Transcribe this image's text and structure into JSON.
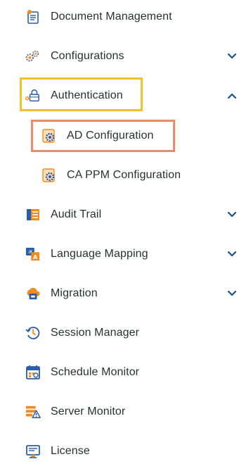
{
  "menu": {
    "document_management": "Document Management",
    "configurations": "Configurations",
    "authentication": "Authentication",
    "ad_configuration": "AD Configuration",
    "ca_ppm_configuration": "CA PPM Configuration",
    "audit_trail": "Audit Trail",
    "language_mapping": "Language Mapping",
    "migration": "Migration",
    "session_manager": "Session Manager",
    "schedule_monitor": "Schedule Monitor",
    "server_monitor": "Server Monitor",
    "license": "License"
  },
  "icons": {
    "document_management": "document-icon",
    "configurations": "gears-icon",
    "authentication": "lock-key-icon",
    "ad_configuration": "gear-document-icon",
    "ca_ppm_configuration": "gear-document-icon",
    "audit_trail": "list-board-icon",
    "language_mapping": "translate-icon",
    "migration": "cloud-migration-icon",
    "session_manager": "clock-history-icon",
    "schedule_monitor": "calendar-icon",
    "server_monitor": "server-warning-icon",
    "license": "license-card-icon"
  },
  "colors": {
    "text": "#2b2f33",
    "chevron": "#1f4e8c",
    "highlight_authentication": "#f2c12e",
    "highlight_ad_configuration": "#f08a69",
    "icon_orange": "#f28b1e",
    "icon_blue": "#2a5da8"
  }
}
